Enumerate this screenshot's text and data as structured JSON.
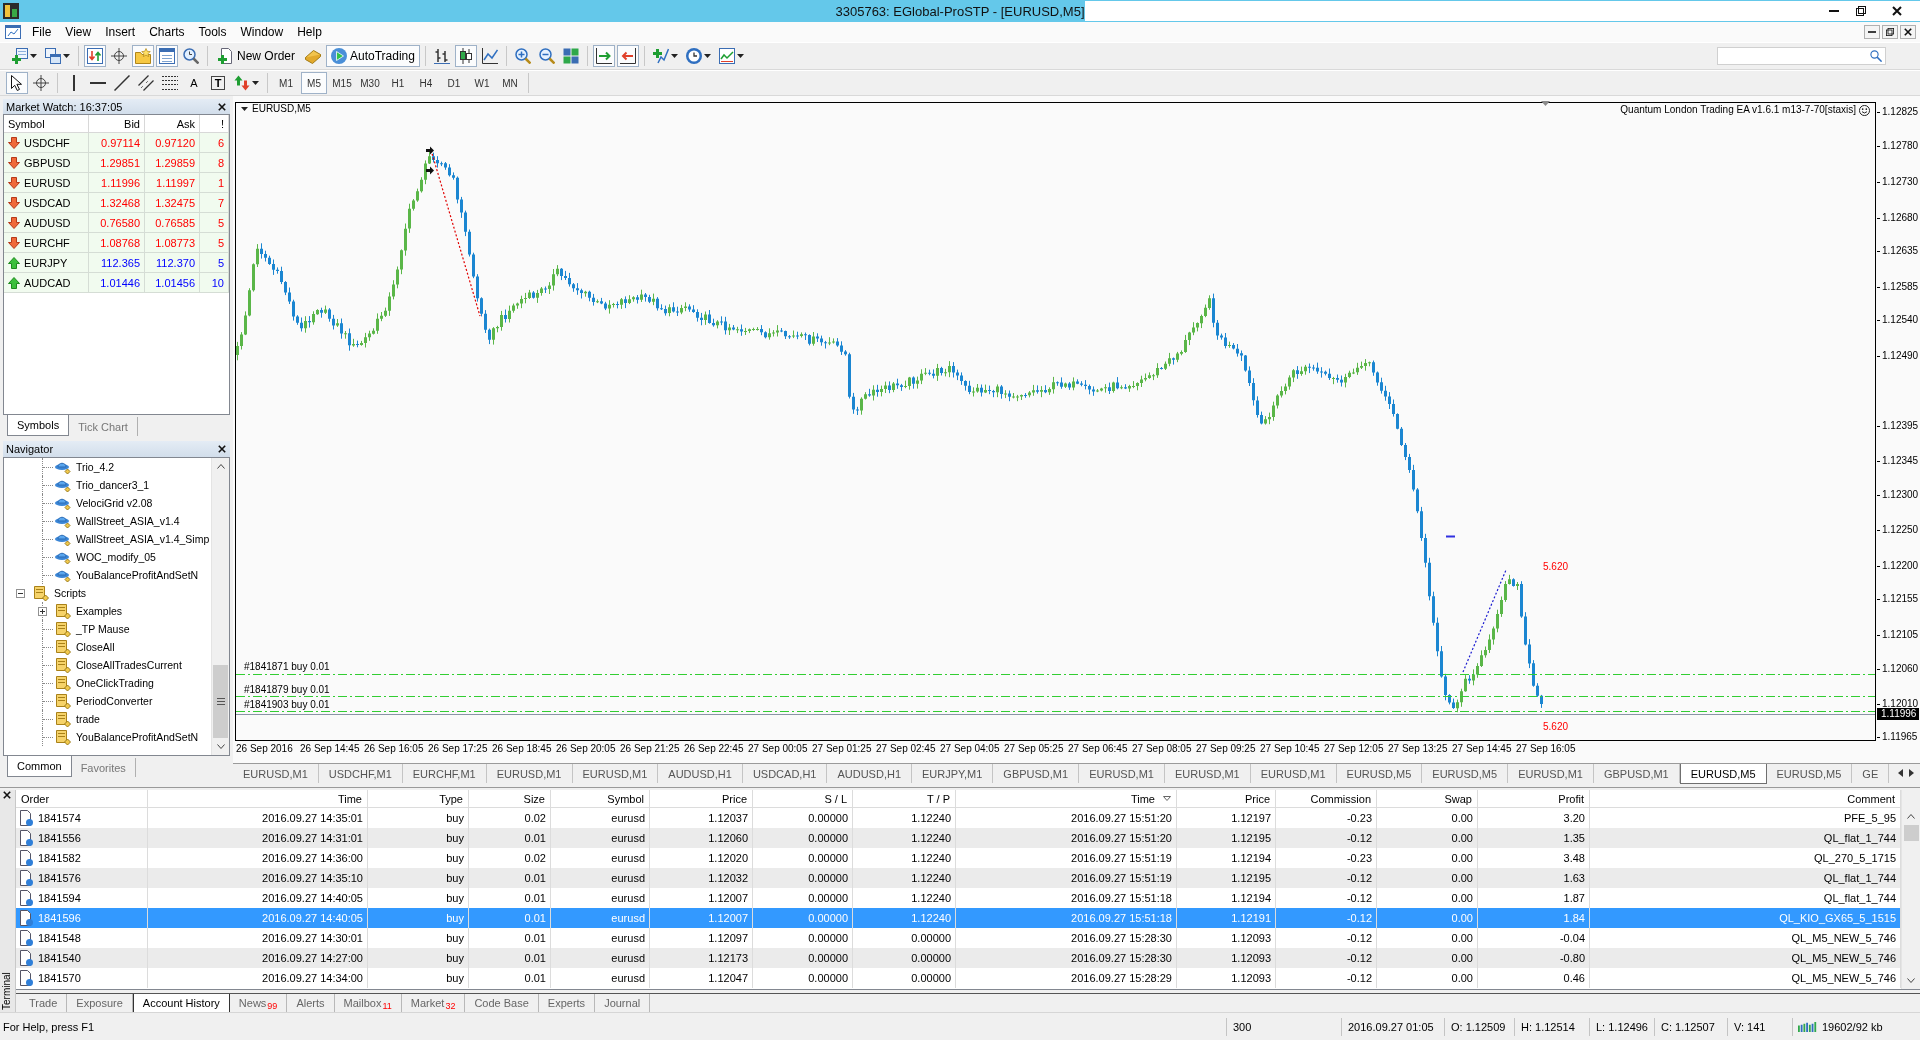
{
  "window": {
    "title": "3305763: EGlobal-ProSTP - [EURUSD,M5]"
  },
  "menu": [
    "File",
    "View",
    "Insert",
    "Charts",
    "Tools",
    "Window",
    "Help"
  ],
  "toolbar": {
    "buttons": [
      {
        "kind": "newchart",
        "pressed": false
      },
      {
        "kind": "profiles",
        "pressed": false
      },
      {
        "kind": "marketwatch",
        "pressed": true
      },
      {
        "kind": "datawindow",
        "pressed": false
      },
      {
        "kind": "navigator",
        "pressed": true
      },
      {
        "kind": "terminal",
        "pressed": true
      },
      {
        "kind": "tester",
        "pressed": false
      },
      {
        "kind": "neworder",
        "label": "New Order",
        "pressed": false
      },
      {
        "kind": "editor",
        "pressed": false
      },
      {
        "kind": "autotrading",
        "label": "AutoTrading",
        "pressed": true
      },
      {
        "kind": "bars",
        "pressed": false
      },
      {
        "kind": "candles",
        "pressed": true
      },
      {
        "kind": "line",
        "pressed": false
      },
      {
        "kind": "zoomin",
        "pressed": false
      },
      {
        "kind": "zoomout",
        "pressed": false
      },
      {
        "kind": "tile",
        "pressed": false
      },
      {
        "kind": "autoscroll",
        "pressed": true
      },
      {
        "kind": "shift",
        "pressed": true
      },
      {
        "kind": "indicators",
        "pressed": false
      },
      {
        "kind": "periods",
        "pressed": false
      },
      {
        "kind": "templates",
        "pressed": false
      }
    ]
  },
  "drawing_tools": [
    {
      "kind": "cursor",
      "pressed": true
    },
    {
      "kind": "crosshair",
      "pressed": false
    },
    {
      "kind": "vline",
      "pressed": false
    },
    {
      "kind": "hline",
      "pressed": false
    },
    {
      "kind": "trend",
      "pressed": false
    },
    {
      "kind": "channel",
      "pressed": false
    },
    {
      "kind": "fibo",
      "pressed": false
    },
    {
      "kind": "text",
      "label": "A",
      "pressed": false
    },
    {
      "kind": "label",
      "label": "T",
      "pressed": false
    },
    {
      "kind": "arrows",
      "pressed": false
    }
  ],
  "timeframes": [
    {
      "label": "M1",
      "selected": false
    },
    {
      "label": "M5",
      "selected": true
    },
    {
      "label": "M15",
      "selected": false
    },
    {
      "label": "M30",
      "selected": false
    },
    {
      "label": "H1",
      "selected": false
    },
    {
      "label": "H4",
      "selected": false
    },
    {
      "label": "D1",
      "selected": false
    },
    {
      "label": "W1",
      "selected": false
    },
    {
      "label": "MN",
      "selected": false
    }
  ],
  "market_watch": {
    "title": "Market Watch: 16:37:05",
    "columns": [
      "Symbol",
      "Bid",
      "Ask",
      "!"
    ],
    "rows": [
      {
        "symbol": "USDCHF",
        "bid": "0.97114",
        "ask": "0.97120",
        "spread": "6",
        "rising": false
      },
      {
        "symbol": "GBPUSD",
        "bid": "1.29851",
        "ask": "1.29859",
        "spread": "8",
        "rising": false
      },
      {
        "symbol": "EURUSD",
        "bid": "1.11996",
        "ask": "1.11997",
        "spread": "1",
        "rising": false
      },
      {
        "symbol": "USDCAD",
        "bid": "1.32468",
        "ask": "1.32475",
        "spread": "7",
        "rising": false
      },
      {
        "symbol": "AUDUSD",
        "bid": "0.76580",
        "ask": "0.76585",
        "spread": "5",
        "rising": false
      },
      {
        "symbol": "EURCHF",
        "bid": "1.08768",
        "ask": "1.08773",
        "spread": "5",
        "rising": false
      },
      {
        "symbol": "EURJPY",
        "bid": "112.365",
        "ask": "112.370",
        "spread": "5",
        "rising": true
      },
      {
        "symbol": "AUDCAD",
        "bid": "1.01446",
        "ask": "1.01456",
        "spread": "10",
        "rising": true
      }
    ],
    "tabs": [
      {
        "label": "Symbols",
        "selected": true
      },
      {
        "label": "Tick Chart",
        "selected": false
      }
    ]
  },
  "navigator": {
    "title": "Navigator",
    "groups": [
      {
        "kind": "experts",
        "children": [
          {
            "label": "Trio_4.2"
          },
          {
            "label": "Trio_dancer3_1"
          },
          {
            "label": "VelociGrid v2.08"
          },
          {
            "label": "WallStreet_ASIA_v1.4"
          },
          {
            "label": "WallStreet_ASIA_v1.4_Simp"
          },
          {
            "label": "WOC_modify_05"
          },
          {
            "label": "YouBalanceProfitAndSetN"
          }
        ]
      },
      {
        "kind": "scripts",
        "label": "Scripts",
        "expanded": true,
        "children": [
          {
            "label": "Examples",
            "expanded": false
          },
          {
            "label": "_TP Mause"
          },
          {
            "label": "CloseAll"
          },
          {
            "label": "CloseAllTradesCurrent"
          },
          {
            "label": "OneClickTrading"
          },
          {
            "label": "PeriodConverter"
          },
          {
            "label": "trade"
          },
          {
            "label": "YouBalanceProfitAndSetN"
          }
        ]
      }
    ],
    "tabs": [
      {
        "label": "Common",
        "selected": true
      },
      {
        "label": "Favorites",
        "selected": false
      }
    ]
  },
  "chart": {
    "symbol": "EURUSD,M5",
    "expert": "Quantum London Trading EA v1.6.1 m13-7-70[staxis]",
    "price_labels": [
      "1.12825",
      "1.12780",
      "1.12730",
      "1.12680",
      "1.12635",
      "1.12585",
      "1.12540",
      "1.12490",
      "1.12395",
      "1.12345",
      "1.12300",
      "1.12250",
      "1.12200",
      "1.12155",
      "1.12105",
      "1.12060",
      "1.12010",
      "1.11965"
    ],
    "current_price": "1.11996",
    "time_labels": [
      "26 Sep 2016",
      "26 Sep 14:45",
      "26 Sep 16:05",
      "26 Sep 17:25",
      "26 Sep 18:45",
      "26 Sep 20:05",
      "26 Sep 21:25",
      "26 Sep 22:45",
      "27 Sep 00:05",
      "27 Sep 01:25",
      "27 Sep 02:45",
      "27 Sep 04:05",
      "27 Sep 05:25",
      "27 Sep 06:45",
      "27 Sep 08:05",
      "27 Sep 09:25",
      "27 Sep 10:45",
      "27 Sep 12:05",
      "27 Sep 13:25",
      "27 Sep 14:45",
      "27 Sep 16:05"
    ],
    "order_lines": [
      "#1841871 buy 0.01",
      "#1841879 buy 0.01",
      "#1841903 buy 0.01"
    ],
    "profit_labels": [
      "5.620",
      "5.620"
    ]
  },
  "chart_tabs": [
    {
      "label": "EURUSD,M1",
      "selected": false
    },
    {
      "label": "USDCHF,M1",
      "selected": false
    },
    {
      "label": "EURCHF,M1",
      "selected": false
    },
    {
      "label": "EURUSD,M1",
      "selected": false
    },
    {
      "label": "EURUSD,M1",
      "selected": false
    },
    {
      "label": "AUDUSD,H1",
      "selected": false
    },
    {
      "label": "USDCAD,H1",
      "selected": false
    },
    {
      "label": "AUDUSD,H1",
      "selected": false
    },
    {
      "label": "EURJPY,M1",
      "selected": false
    },
    {
      "label": "GBPUSD,M1",
      "selected": false
    },
    {
      "label": "EURUSD,M1",
      "selected": false
    },
    {
      "label": "EURUSD,M1",
      "selected": false
    },
    {
      "label": "EURUSD,M1",
      "selected": false
    },
    {
      "label": "EURUSD,M5",
      "selected": false
    },
    {
      "label": "EURUSD,M5",
      "selected": false
    },
    {
      "label": "EURUSD,M1",
      "selected": false
    },
    {
      "label": "GBPUSD,M1",
      "selected": false
    },
    {
      "label": "EURUSD,M5",
      "selected": true
    },
    {
      "label": "EURUSD,M5",
      "selected": false
    },
    {
      "label": "GE",
      "selected": false
    }
  ],
  "terminal": {
    "title": "Terminal",
    "columns": [
      {
        "label": "Order",
        "sorted": false
      },
      {
        "label": "Time",
        "sorted": false
      },
      {
        "label": "Type",
        "sorted": false
      },
      {
        "label": "Size",
        "sorted": false
      },
      {
        "label": "Symbol",
        "sorted": false
      },
      {
        "label": "Price",
        "sorted": false
      },
      {
        "label": "S / L",
        "sorted": false
      },
      {
        "label": "T / P",
        "sorted": false
      },
      {
        "label": "Time",
        "sorted": true
      },
      {
        "label": "Price",
        "sorted": false
      },
      {
        "label": "Commission",
        "sorted": false
      },
      {
        "label": "Swap",
        "sorted": false
      },
      {
        "label": "Profit",
        "sorted": false
      },
      {
        "label": "Comment",
        "sorted": false
      }
    ],
    "rows": [
      {
        "cells": [
          "1841574",
          "2016.09.27 14:35:01",
          "buy",
          "0.02",
          "eurusd",
          "1.12037",
          "0.00000",
          "1.12240",
          "2016.09.27 15:51:20",
          "1.12197",
          "-0.23",
          "0.00",
          "3.20",
          "PFE_5_95"
        ],
        "selected": false
      },
      {
        "cells": [
          "1841556",
          "2016.09.27 14:31:01",
          "buy",
          "0.01",
          "eurusd",
          "1.12060",
          "0.00000",
          "1.12240",
          "2016.09.27 15:51:20",
          "1.12195",
          "-0.12",
          "0.00",
          "1.35",
          "QL_flat_1_744"
        ],
        "selected": false
      },
      {
        "cells": [
          "1841582",
          "2016.09.27 14:36:00",
          "buy",
          "0.02",
          "eurusd",
          "1.12020",
          "0.00000",
          "1.12240",
          "2016.09.27 15:51:19",
          "1.12194",
          "-0.23",
          "0.00",
          "3.48",
          "QL_270_5_1715"
        ],
        "selected": false
      },
      {
        "cells": [
          "1841576",
          "2016.09.27 14:35:10",
          "buy",
          "0.01",
          "eurusd",
          "1.12032",
          "0.00000",
          "1.12240",
          "2016.09.27 15:51:19",
          "1.12195",
          "-0.12",
          "0.00",
          "1.63",
          "QL_flat_1_744"
        ],
        "selected": false
      },
      {
        "cells": [
          "1841594",
          "2016.09.27 14:40:05",
          "buy",
          "0.01",
          "eurusd",
          "1.12007",
          "0.00000",
          "1.12240",
          "2016.09.27 15:51:18",
          "1.12194",
          "-0.12",
          "0.00",
          "1.87",
          "QL_flat_1_744"
        ],
        "selected": false
      },
      {
        "cells": [
          "1841596",
          "2016.09.27 14:40:05",
          "buy",
          "0.01",
          "eurusd",
          "1.12007",
          "0.00000",
          "1.12240",
          "2016.09.27 15:51:18",
          "1.12191",
          "-0.12",
          "0.00",
          "1.84",
          "QL_KIO_GX65_5_1515"
        ],
        "selected": true
      },
      {
        "cells": [
          "1841548",
          "2016.09.27 14:30:01",
          "buy",
          "0.01",
          "eurusd",
          "1.12097",
          "0.00000",
          "0.00000",
          "2016.09.27 15:28:30",
          "1.12093",
          "-0.12",
          "0.00",
          "-0.04",
          "QL_M5_NEW_5_746"
        ],
        "selected": false
      },
      {
        "cells": [
          "1841540",
          "2016.09.27 14:27:00",
          "buy",
          "0.01",
          "eurusd",
          "1.12173",
          "0.00000",
          "0.00000",
          "2016.09.27 15:28:30",
          "1.12093",
          "-0.12",
          "0.00",
          "-0.80",
          "QL_M5_NEW_5_746"
        ],
        "selected": false
      },
      {
        "cells": [
          "1841570",
          "2016.09.27 14:34:00",
          "buy",
          "0.01",
          "eurusd",
          "1.12047",
          "0.00000",
          "0.00000",
          "2016.09.27 15:28:29",
          "1.12093",
          "-0.12",
          "0.00",
          "0.46",
          "QL_M5_NEW_5_746"
        ],
        "selected": false
      }
    ],
    "tabs": [
      {
        "label": "Trade",
        "selected": false
      },
      {
        "label": "Exposure",
        "selected": false
      },
      {
        "label": "Account History",
        "selected": true
      },
      {
        "label": "News",
        "count": "99",
        "selected": false
      },
      {
        "label": "Alerts",
        "selected": false
      },
      {
        "label": "Mailbox",
        "count": "11",
        "selected": false
      },
      {
        "label": "Market",
        "count": "32",
        "selected": false
      },
      {
        "label": "Code Base",
        "selected": false
      },
      {
        "label": "Experts",
        "selected": false
      },
      {
        "label": "Journal",
        "selected": false
      }
    ]
  },
  "status_bar": {
    "help": "For Help, press F1",
    "fields": [
      "300",
      "2016.09.27 01:05",
      "O: 1.12509",
      "H: 1.12514",
      "L: 1.12496",
      "C: 1.12507",
      "V: 141"
    ],
    "traffic": "19602/92 kb"
  }
}
